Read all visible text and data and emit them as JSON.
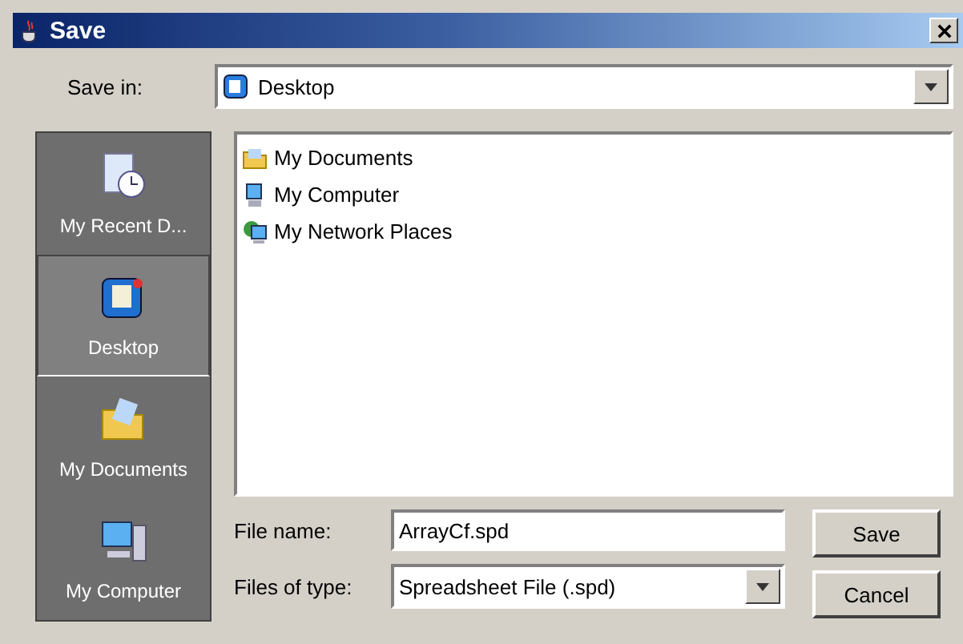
{
  "window": {
    "title": "Save"
  },
  "save_in": {
    "label": "Save in:",
    "value": "Desktop"
  },
  "places": [
    {
      "label": "My Recent D...",
      "kind": "recent",
      "selected": false
    },
    {
      "label": "Desktop",
      "kind": "desktop",
      "selected": true
    },
    {
      "label": "My Documents",
      "kind": "documents",
      "selected": false
    },
    {
      "label": "My Computer",
      "kind": "computer",
      "selected": false
    }
  ],
  "files": [
    {
      "name": "My Documents",
      "kind": "documents"
    },
    {
      "name": "My Computer",
      "kind": "computer"
    },
    {
      "name": "My Network Places",
      "kind": "network"
    }
  ],
  "file_name": {
    "label": "File name:",
    "value": "ArrayCf.spd"
  },
  "file_type": {
    "label": "Files of type:",
    "value": "Spreadsheet File (.spd)"
  },
  "buttons": [
    "Save",
    "Cancel"
  ]
}
